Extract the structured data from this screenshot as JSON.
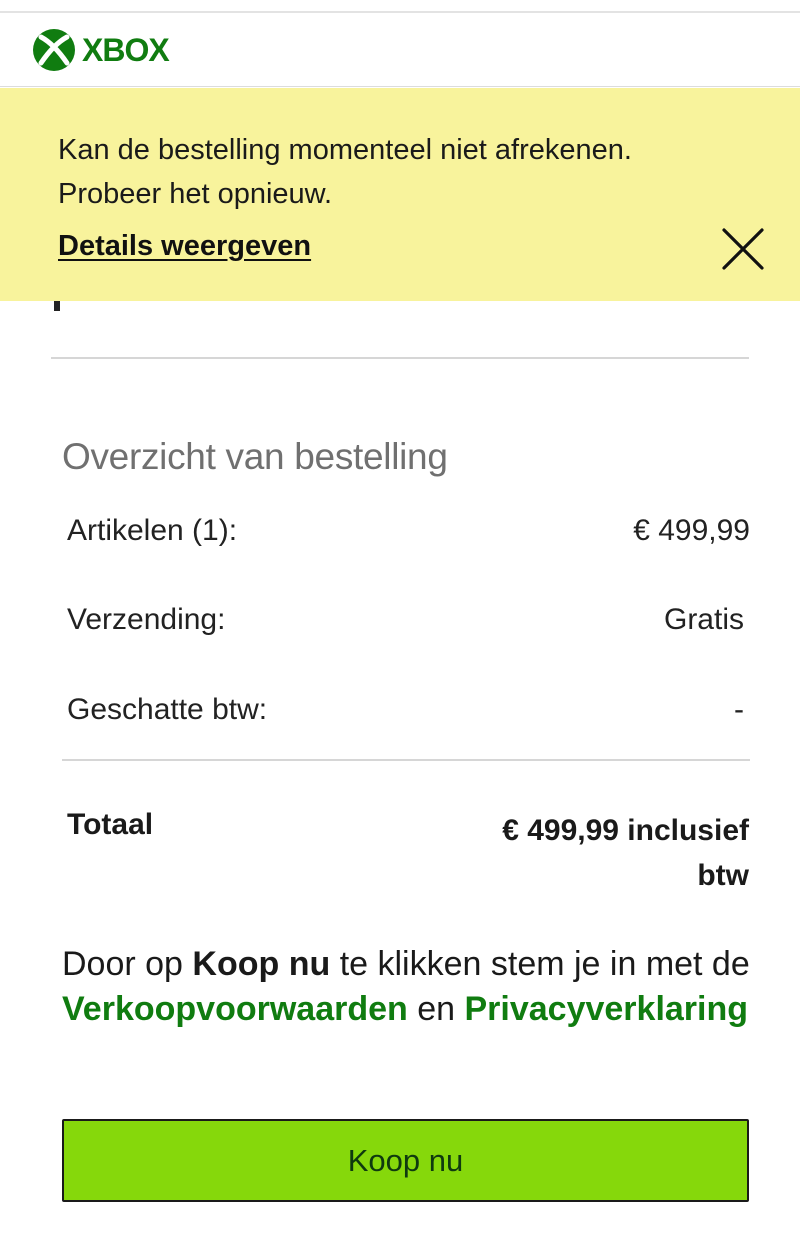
{
  "brand": {
    "logo_text": "XBOX",
    "color": "#107c10",
    "icon": "xbox-logo-icon"
  },
  "alert": {
    "message": "Kan de bestelling momenteel niet afrekenen. Probeer het opnieuw.",
    "link": "Details weergeven",
    "background": "#f8f39c",
    "close_icon": "close-icon"
  },
  "summary": {
    "title": "Overzicht van bestelling",
    "rows": [
      {
        "label": "Artikelen (1):",
        "value": "€ 499,99"
      },
      {
        "label": "Verzending:",
        "value": "Gratis"
      },
      {
        "label": "Geschatte btw:",
        "value": "-"
      }
    ],
    "total_label": "Totaal",
    "total_value": "€ 499,99 inclusief btw"
  },
  "terms": {
    "prefix": "Door op ",
    "action_name": "Koop nu",
    "middle": " te klikken stem je in met de ",
    "sales_terms_link": "Verkoopvoorwaarden",
    "conjunction": " en ",
    "privacy_link": "Privacyverklaring"
  },
  "buy_button": {
    "label": "Koop nu",
    "color": "#86d80b"
  }
}
